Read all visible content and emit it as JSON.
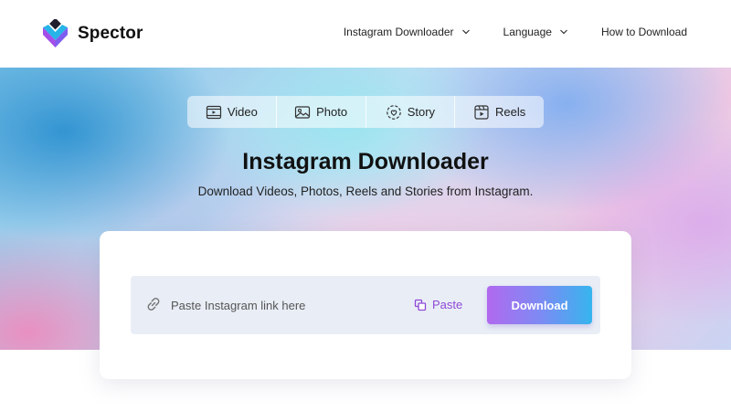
{
  "brand": {
    "name": "Spector"
  },
  "nav": {
    "items": [
      {
        "label": "Instagram Downloader",
        "has_dropdown": true
      },
      {
        "label": "Language",
        "has_dropdown": true
      },
      {
        "label": "How to Download",
        "has_dropdown": false
      }
    ]
  },
  "tabs": [
    {
      "label": "Video",
      "icon": "video-icon"
    },
    {
      "label": "Photo",
      "icon": "photo-icon"
    },
    {
      "label": "Story",
      "icon": "story-icon"
    },
    {
      "label": "Reels",
      "icon": "reels-icon"
    }
  ],
  "hero": {
    "title": "Instagram Downloader",
    "subtitle": "Download Videos, Photos, Reels and Stories from Instagram."
  },
  "form": {
    "input_placeholder": "Paste Instagram link here",
    "input_value": "",
    "paste_label": "Paste",
    "download_label": "Download"
  },
  "colors": {
    "accent_purple": "#8f48d8",
    "button_gradient_start": "#b169ef",
    "button_gradient_end": "#36b5ee",
    "input_background": "#e9eef6"
  }
}
